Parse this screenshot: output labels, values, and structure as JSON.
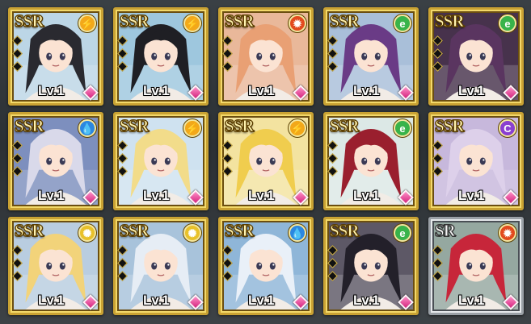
{
  "roster": {
    "cards": [
      {
        "rarity": "SSR",
        "element": "thunder-icon",
        "element_color": "#f2a81a",
        "element_glyph": "⚡",
        "level": "Lv.1",
        "hair": "#2a2a30",
        "bg": "#bcd6e6"
      },
      {
        "rarity": "SSR",
        "element": "thunder-icon",
        "element_color": "#f2a81a",
        "element_glyph": "⚡",
        "level": "Lv.1",
        "hair": "#1f1f24",
        "bg": "#9ec7de"
      },
      {
        "rarity": "SSR",
        "element": "fire-icon",
        "element_color": "#e24a1e",
        "element_glyph": "✹",
        "level": "Lv.1",
        "hair": "#e9a074",
        "bg": "#e9b89a"
      },
      {
        "rarity": "SSR",
        "element": "wind-icon",
        "element_color": "#38b34a",
        "element_glyph": "e",
        "level": "Lv.1",
        "hair": "#6a3b86",
        "bg": "#a9bfd9"
      },
      {
        "rarity": "SSR",
        "element": "wind-icon",
        "element_color": "#38b34a",
        "element_glyph": "e",
        "level": "Lv.1",
        "hair": "#5a3560",
        "bg": "#47324c"
      },
      {
        "rarity": "SSR",
        "element": "water-icon",
        "element_color": "#2b87e0",
        "element_glyph": "💧",
        "level": "Lv.1",
        "hair": "#d9d9ea",
        "bg": "#7d8fbe"
      },
      {
        "rarity": "SSR",
        "element": "thunder-icon",
        "element_color": "#f2a81a",
        "element_glyph": "⚡",
        "level": "Lv.1",
        "hair": "#f2dc8a",
        "bg": "#cfe2f0"
      },
      {
        "rarity": "SSR",
        "element": "thunder-icon",
        "element_color": "#f2a81a",
        "element_glyph": "⚡",
        "level": "Lv.1",
        "hair": "#f0cd4e",
        "bg": "#f3e3a0"
      },
      {
        "rarity": "SSR",
        "element": "wind-icon",
        "element_color": "#38b34a",
        "element_glyph": "e",
        "level": "Lv.1",
        "hair": "#9a1f2e",
        "bg": "#dce8e6"
      },
      {
        "rarity": "SSR",
        "element": "dark-icon",
        "element_color": "#8a3fd0",
        "element_glyph": "C",
        "level": "Lv.1",
        "hair": "#ddd0ea",
        "bg": "#c7b8dc"
      },
      {
        "rarity": "SSR",
        "element": "light-icon",
        "element_color": "#e8c12a",
        "element_glyph": "✺",
        "level": "Lv.1",
        "hair": "#f2d37a",
        "bg": "#b9cde0"
      },
      {
        "rarity": "SSR",
        "element": "light-icon",
        "element_color": "#e8c12a",
        "element_glyph": "✺",
        "level": "Lv.1",
        "hair": "#e6edf5",
        "bg": "#a8c3db"
      },
      {
        "rarity": "SSR",
        "element": "water-icon",
        "element_color": "#2b87e0",
        "element_glyph": "💧",
        "level": "Lv.1",
        "hair": "#e9f0f8",
        "bg": "#8fb6d8"
      },
      {
        "rarity": "SSR",
        "element": "wind-icon",
        "element_color": "#38b34a",
        "element_glyph": "e",
        "level": "Lv.1",
        "hair": "#23202a",
        "bg": "#5d5866"
      },
      {
        "rarity": "SR",
        "element": "fire-icon",
        "element_color": "#e24a1e",
        "element_glyph": "✹",
        "level": "Lv.1",
        "hair": "#c7263a",
        "bg": "#95a8a0"
      }
    ]
  }
}
